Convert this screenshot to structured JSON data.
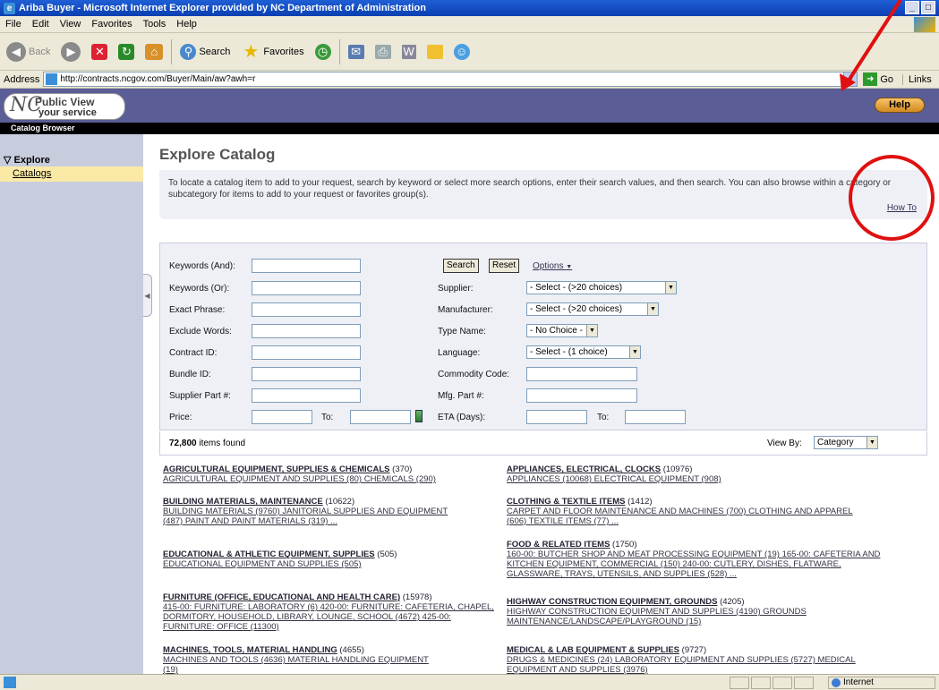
{
  "window": {
    "title": "Ariba Buyer - Microsoft Internet Explorer provided by NC Department of Administration"
  },
  "menu": [
    "File",
    "Edit",
    "View",
    "Favorites",
    "Tools",
    "Help"
  ],
  "toolbar": {
    "back": "Back",
    "search": "Search",
    "favorites": "Favorites"
  },
  "address": {
    "label": "Address",
    "url": "http://contracts.ncgov.com/Buyer/Main/aw?awh=r",
    "go": "Go",
    "links": "Links"
  },
  "header": {
    "logo_nc": "NC",
    "logo_pv": "Public View",
    "logo_ys": "your service",
    "help": "Help",
    "catalog_bar": "Catalog Browser"
  },
  "sidebar": {
    "explore": "Explore",
    "catalogs": "Catalogs"
  },
  "main": {
    "title": "Explore Catalog",
    "info": "To locate a catalog item to add to your request, search by keyword or select more search options, enter their search values, and then search. You can also browse within a category or subcategory for items to add to your request or favorites group(s).",
    "howto": "How To"
  },
  "search": {
    "kw_and": "Keywords (And):",
    "kw_or": "Keywords (Or):",
    "exact": "Exact Phrase:",
    "exclude": "Exclude Words:",
    "contract": "Contract ID:",
    "bundle": "Bundle ID:",
    "supplier_part": "Supplier Part #:",
    "price": "Price:",
    "to": "To:",
    "search_btn": "Search",
    "reset_btn": "Reset",
    "options": "Options",
    "supplier": "Supplier:",
    "supplier_val": "- Select - (>20 choices)",
    "manufacturer": "Manufacturer:",
    "manufacturer_val": "- Select - (>20 choices)",
    "type_name": "Type Name:",
    "type_name_val": "- No Choice -",
    "language": "Language:",
    "language_val": "- Select - (1 choice)",
    "commodity": "Commodity Code:",
    "mfg_part": "Mfg. Part #:",
    "eta": "ETA (Days):"
  },
  "results": {
    "count": "72,800",
    "count_suffix": "items found",
    "viewby": "View By:",
    "viewby_val": "Category"
  },
  "categories": [
    {
      "title": "AGRICULTURAL EQUIPMENT, SUPPLIES & CHEMICALS",
      "count": "(370)",
      "subs": "AGRICULTURAL EQUIPMENT AND SUPPLIES (80)  CHEMICALS (290)"
    },
    {
      "title": "APPLIANCES, ELECTRICAL, CLOCKS",
      "count": "(10976)",
      "subs": "APPLIANCES (10068)  ELECTRICAL EQUIPMENT (908)"
    },
    {
      "title": "BUILDING MATERIALS, MAINTENANCE",
      "count": "(10622)",
      "subs": "BUILDING MATERIALS (9760)  JANITORIAL SUPPLIES AND EQUIPMENT (487)  PAINT AND PAINT MATERIALS (319)  ..."
    },
    {
      "title": "CLOTHING & TEXTILE ITEMS",
      "count": "(1412)",
      "subs": "CARPET AND FLOOR MAINTENANCE AND MACHINES (700)  CLOTHING AND APPAREL (606)  TEXTILE ITEMS (77)  ..."
    },
    {
      "title": "EDUCATIONAL & ATHLETIC EQUIPMENT, SUPPLIES",
      "count": "(505)",
      "subs": "EDUCATIONAL EQUIPMENT AND SUPPLIES (505)"
    },
    {
      "title": "FOOD & RELATED ITEMS",
      "count": "(1750)",
      "subs": "160-00: BUTCHER SHOP AND MEAT PROCESSING EQUIPMENT (19)  165-00: CAFETERIA AND KITCHEN EQUIPMENT, COMMERCIAL (150)  240-00: CUTLERY, DISHES, FLATWARE, GLASSWARE, TRAYS, UTENSILS, AND SUPPLIES (528)  ..."
    },
    {
      "title": "FURNITURE (OFFICE, EDUCATIONAL AND HEALTH CARE)",
      "count": "(15978)",
      "subs": "415-00: FURNITURE: LABORATORY (6)  420-00: FURNITURE: CAFETERIA, CHAPEL, DORMITORY, HOUSEHOLD, LIBRARY, LOUNGE, SCHOOL (4672)  425-00: FURNITURE: OFFICE (11300)"
    },
    {
      "title": "HIGHWAY CONSTRUCTION EQUIPMENT, GROUNDS",
      "count": "(4205)",
      "subs": "HIGHWAY CONSTRUCTION EQUIPMENT AND SUPPLIES (4190)  GROUNDS MAINTENANCE/LANDSCAPE/PLAYGROUND (15)"
    },
    {
      "title": "MACHINES, TOOLS, MATERIAL HANDLING",
      "count": "(4655)",
      "subs": "MACHINES AND TOOLS (4636)  MATERIAL HANDLING EQUIPMENT (19)"
    },
    {
      "title": "MEDICAL & LAB EQUIPMENT & SUPPLIES",
      "count": "(9727)",
      "subs": "DRUGS & MEDICINES (24)  LABORATORY EQUIPMENT AND SUPPLIES (5727)  MEDICAL EQUIPMENT AND SUPPLIES (3976)"
    }
  ],
  "status": {
    "zone": "Internet"
  },
  "colors": {
    "header": "#5b5d97",
    "sidebar": "#c8cdde",
    "annotation": "#e01010"
  }
}
